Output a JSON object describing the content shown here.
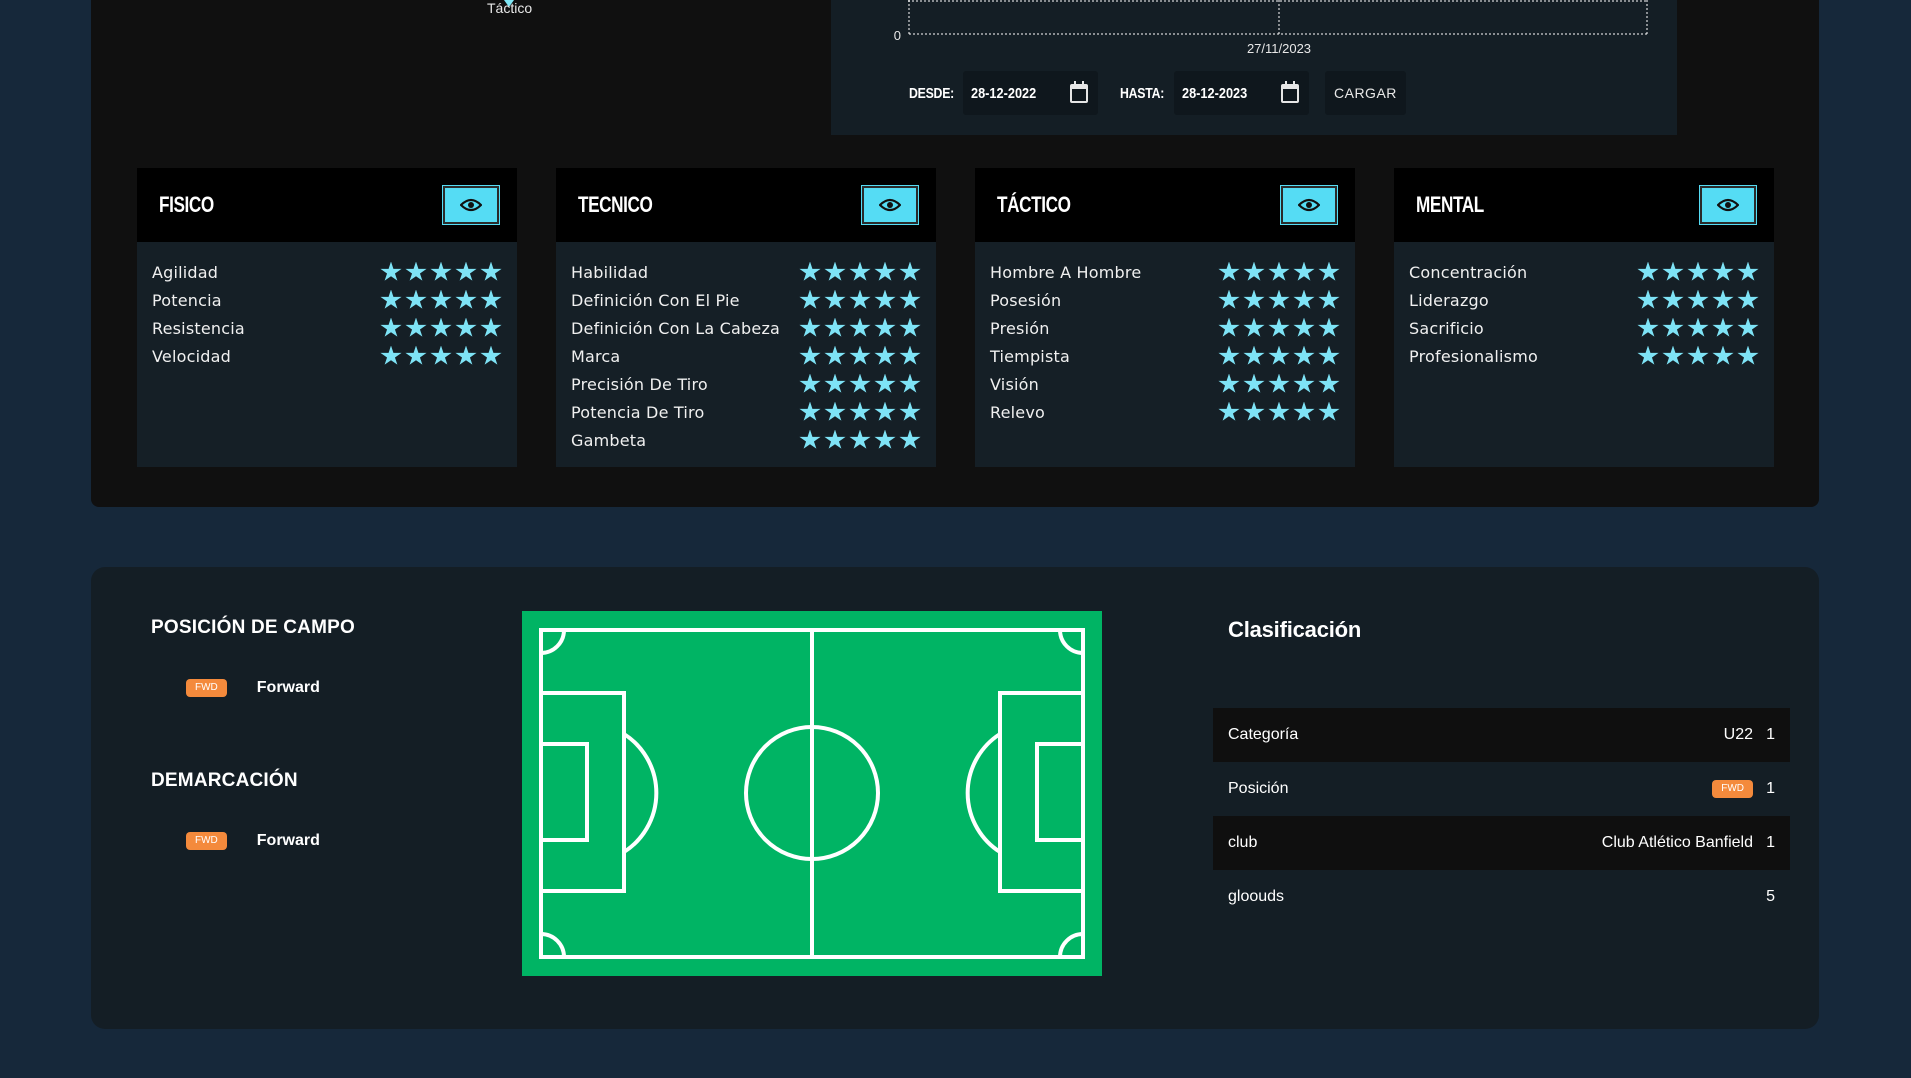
{
  "radar": {
    "label": "Táctico"
  },
  "chart": {
    "y_tick": "0",
    "x_tick": "27/11/2023",
    "desde_label": "DESDE:",
    "desde_value": "28-12-2022",
    "hasta_label": "HASTA:",
    "hasta_value": "28-12-2023",
    "cargar_label": "CARGAR"
  },
  "chart_data": {
    "type": "line",
    "categories": [
      "27/11/2023"
    ],
    "y_ticks": [
      "0"
    ]
  },
  "cards": [
    {
      "title": "FISICO",
      "items": [
        {
          "label": "Agilidad",
          "stars": 5
        },
        {
          "label": "Potencia",
          "stars": 5
        },
        {
          "label": "Resistencia",
          "stars": 5
        },
        {
          "label": "Velocidad",
          "stars": 5
        }
      ]
    },
    {
      "title": "TECNICO",
      "items": [
        {
          "label": "Habilidad",
          "stars": 5
        },
        {
          "label": "Definición Con El Pie",
          "stars": 5
        },
        {
          "label": "Definición Con La Cabeza",
          "stars": 5
        },
        {
          "label": "Marca",
          "stars": 5
        },
        {
          "label": "Precisión De Tiro",
          "stars": 5
        },
        {
          "label": "Potencia De Tiro",
          "stars": 5
        },
        {
          "label": "Gambeta",
          "stars": 5
        }
      ]
    },
    {
      "title": "TÁCTICO",
      "items": [
        {
          "label": "Hombre A Hombre",
          "stars": 5
        },
        {
          "label": "Posesión",
          "stars": 5
        },
        {
          "label": "Presión",
          "stars": 5
        },
        {
          "label": "Tiempista",
          "stars": 5
        },
        {
          "label": "Visión",
          "stars": 5
        },
        {
          "label": "Relevo",
          "stars": 5
        }
      ]
    },
    {
      "title": "MENTAL",
      "items": [
        {
          "label": "Concentración",
          "stars": 5
        },
        {
          "label": "Liderazgo",
          "stars": 5
        },
        {
          "label": "Sacrificio",
          "stars": 5
        },
        {
          "label": "Profesionalismo",
          "stars": 5
        }
      ]
    }
  ],
  "position": {
    "title": "POSICIÓN DE CAMPO",
    "badge": "FWD",
    "name": "Forward"
  },
  "demarcation": {
    "title": "DEMARCACIÓN",
    "badge": "FWD",
    "name": "Forward"
  },
  "classification": {
    "title": "Clasificación",
    "rows": [
      {
        "key": "Categoría",
        "value": "U22",
        "count": "1"
      },
      {
        "key": "Posición",
        "badge": "FWD",
        "count": "1"
      },
      {
        "key": "club",
        "value": "Club Atlético Banfield",
        "count": "1"
      },
      {
        "key": "gloouds",
        "value": "",
        "count": "5"
      }
    ]
  },
  "colors": {
    "accent": "#55dcf4",
    "star": "#7ee3f6",
    "badge": "#f48a3c",
    "field": "#00b464",
    "background": "#16283a"
  },
  "icons": {
    "calendar": "calendar-icon",
    "eye": "eye-icon",
    "star": "star-icon"
  }
}
